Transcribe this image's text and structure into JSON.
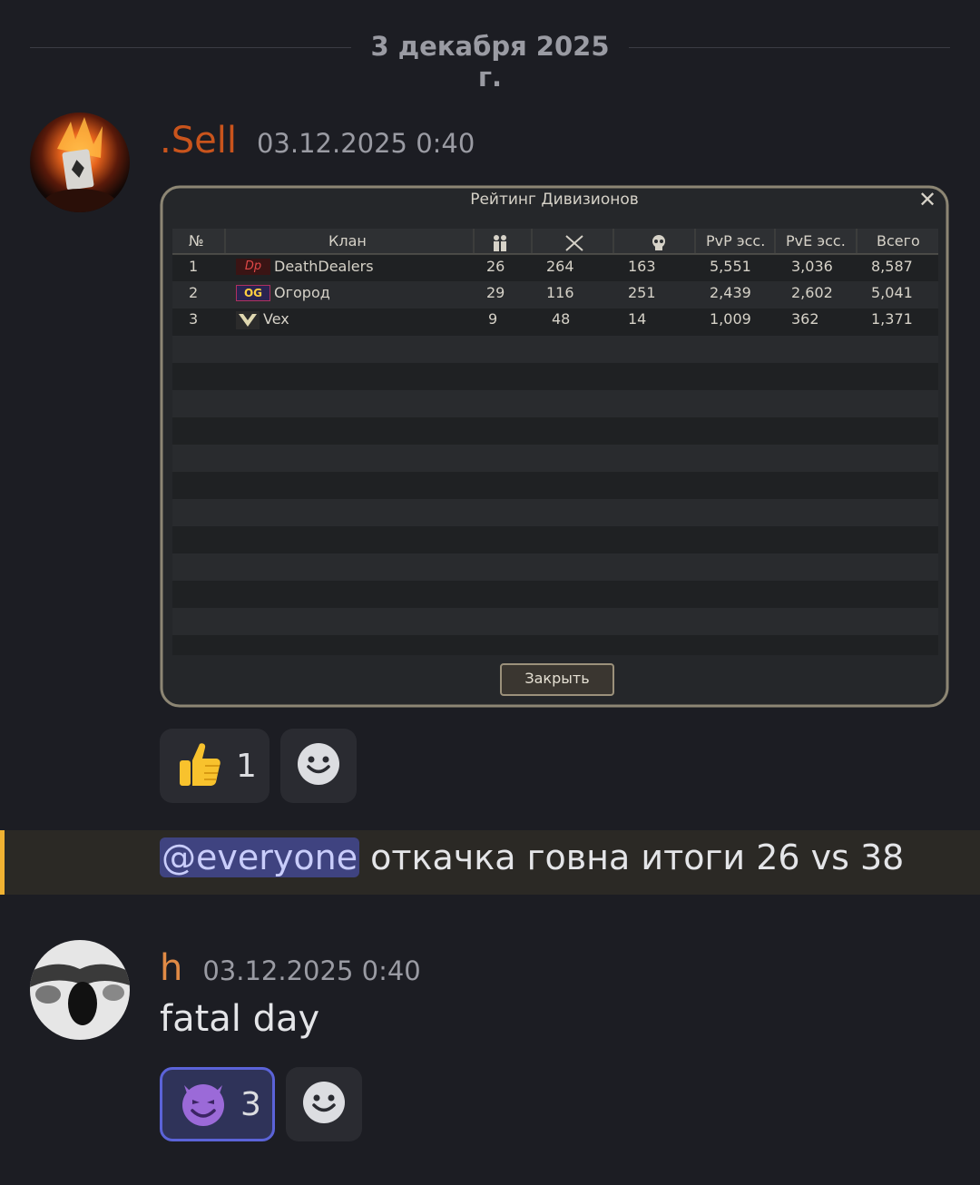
{
  "date_divider": "3 декабря 2025 г.",
  "messages": [
    {
      "author": ".Sell",
      "author_color": "#c9541c",
      "timestamp": "03.12.2025 0:40",
      "attachment": {
        "window_title": "Рейтинг Дивизионов",
        "columns": [
          "№",
          "Клан",
          "members-icon",
          "swords-icon",
          "skull-icon",
          "PvP эсс.",
          "PvE эсс.",
          "Всего"
        ],
        "rows": [
          {
            "rank": "1",
            "badge": "Dp",
            "clan": "DeathDealers",
            "members": "26",
            "kills": "264",
            "deaths": "163",
            "pvp": "5,551",
            "pve": "3,036",
            "total": "8,587"
          },
          {
            "rank": "2",
            "badge": "OG",
            "clan": "Огород",
            "members": "29",
            "kills": "116",
            "deaths": "251",
            "pvp": "2,439",
            "pve": "2,602",
            "total": "5,041"
          },
          {
            "rank": "3",
            "badge": "",
            "clan": "Vex",
            "members": "9",
            "kills": "48",
            "deaths": "14",
            "pvp": "1,009",
            "pve": "362",
            "total": "1,371"
          }
        ],
        "close_button": "Закрыть"
      },
      "reactions": [
        {
          "emoji": "thumbs-up-icon",
          "count": "1",
          "active": false
        }
      ]
    },
    {
      "mention": "@everyone",
      "text": "откачка говна итоги 26 vs 38"
    },
    {
      "author": "h",
      "author_color": "#e08a45",
      "timestamp": "03.12.2025 0:40",
      "text": "fatal day",
      "reactions": [
        {
          "emoji": "smiling-devil-icon",
          "count": "3",
          "active": true
        }
      ]
    }
  ],
  "colors": {
    "background": "#1c1d23",
    "mention_highlight": "#f0b232",
    "reaction_active": "#5b63d8"
  }
}
